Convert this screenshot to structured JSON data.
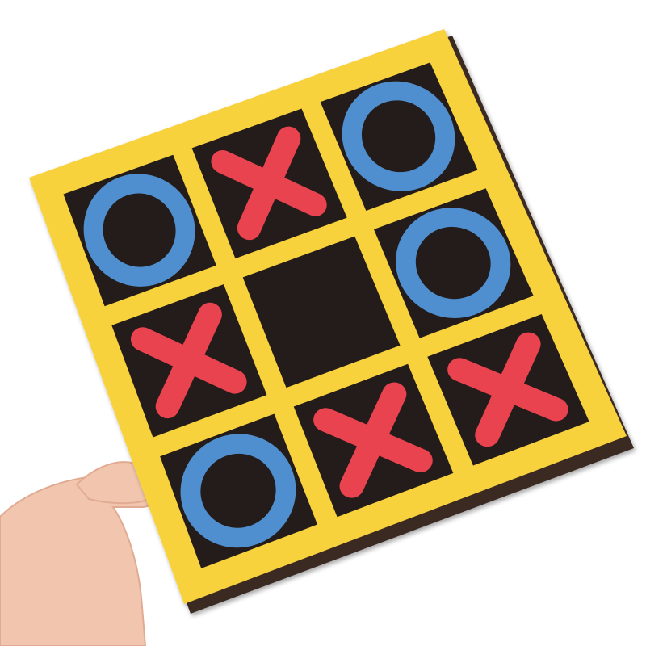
{
  "game": {
    "name": "tic-tac-toe",
    "board": {
      "rows": 3,
      "cols": 3,
      "cells": [
        [
          "O",
          "X",
          "O"
        ],
        [
          "X",
          "",
          "O"
        ],
        [
          "O",
          "X",
          "X"
        ]
      ]
    },
    "pieces": {
      "X": {
        "shape": "cross",
        "color": "#e8434f"
      },
      "O": {
        "shape": "ring",
        "color": "#4f8fcf"
      }
    },
    "colors": {
      "frame": "#f7d23e",
      "cell": "#231c1a",
      "background": "#ffffff",
      "skin": "#f2c6ae"
    },
    "counts": {
      "X": 4,
      "O": 4,
      "empty": 1
    }
  }
}
